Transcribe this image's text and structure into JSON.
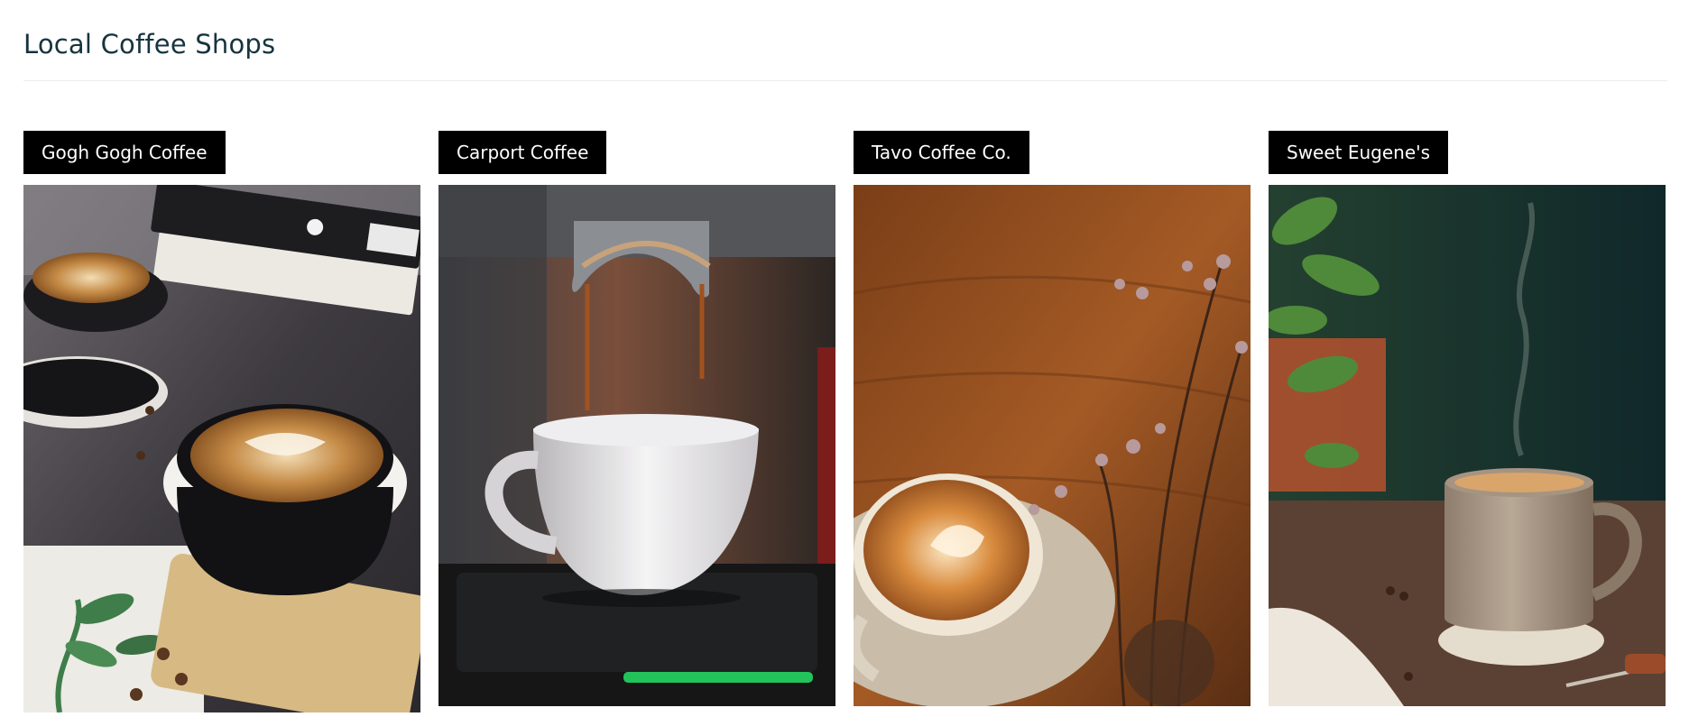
{
  "page": {
    "title": "Local Coffee Shops"
  },
  "shops": [
    {
      "name": "Gogh Gogh Coffee",
      "photo_icon": "latte-art-cup-with-books-icon"
    },
    {
      "name": "Carport Coffee",
      "photo_icon": "espresso-machine-pouring-icon"
    },
    {
      "name": "Tavo Coffee Co.",
      "photo_icon": "latte-on-wood-table-with-flowers-icon"
    },
    {
      "name": "Sweet Eugene's",
      "photo_icon": "steaming-mug-icon"
    }
  ],
  "colors": {
    "title": "#16343f",
    "label_background": "#000000",
    "label_text": "#ffffff",
    "divider": "#ececec"
  }
}
